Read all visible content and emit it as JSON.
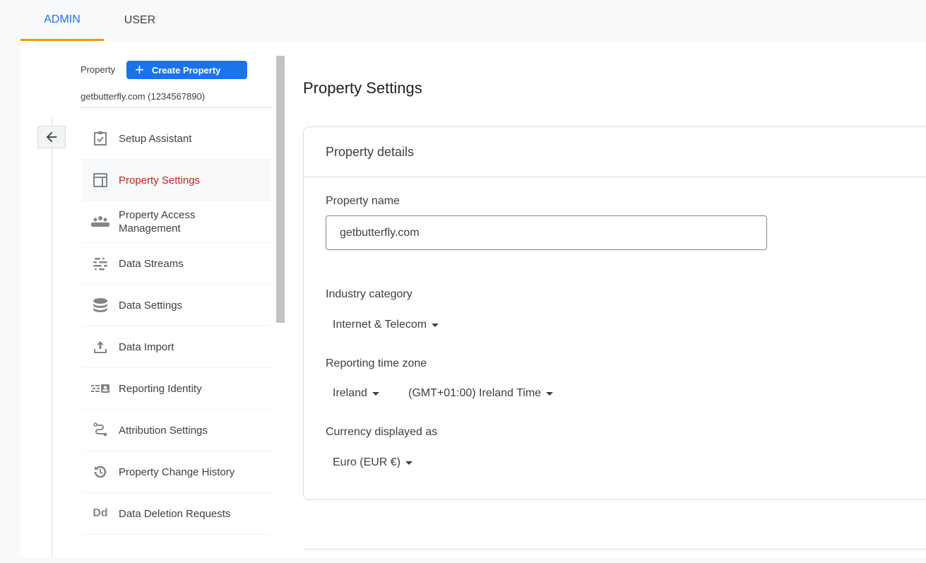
{
  "tabs": [
    {
      "label": "ADMIN",
      "active": true
    },
    {
      "label": "USER",
      "active": false
    }
  ],
  "sidebar": {
    "property_label": "Property",
    "create_button": "Create Property",
    "property_id": "getbutterfly.com (1234567890)",
    "items": [
      {
        "label": "Setup Assistant",
        "icon": "clipboard-check-icon"
      },
      {
        "label": "Property Settings",
        "icon": "layout-icon",
        "active": true
      },
      {
        "label": "Property Access Management",
        "icon": "people-icon"
      },
      {
        "label": "Data Streams",
        "icon": "streams-icon"
      },
      {
        "label": "Data Settings",
        "icon": "database-icon"
      },
      {
        "label": "Data Import",
        "icon": "upload-icon"
      },
      {
        "label": "Reporting Identity",
        "icon": "identity-icon"
      },
      {
        "label": "Attribution Settings",
        "icon": "attribution-icon"
      },
      {
        "label": "Property Change History",
        "icon": "history-icon"
      },
      {
        "label": "Data Deletion Requests",
        "icon": "dd-icon"
      }
    ]
  },
  "main": {
    "title": "Property Settings",
    "card_title": "Property details",
    "property_name_label": "Property name",
    "property_name_value": "getbutterfly.com",
    "industry_label": "Industry category",
    "industry_value": "Internet & Telecom",
    "timezone_label": "Reporting time zone",
    "timezone_country": "Ireland",
    "timezone_value": "(GMT+01:00) Ireland Time",
    "currency_label": "Currency displayed as",
    "currency_value": "Euro (EUR €)"
  },
  "colors": {
    "accent": "#1a73e8",
    "active_tab_underline": "#f29900",
    "active_nav": "#c5221f"
  }
}
